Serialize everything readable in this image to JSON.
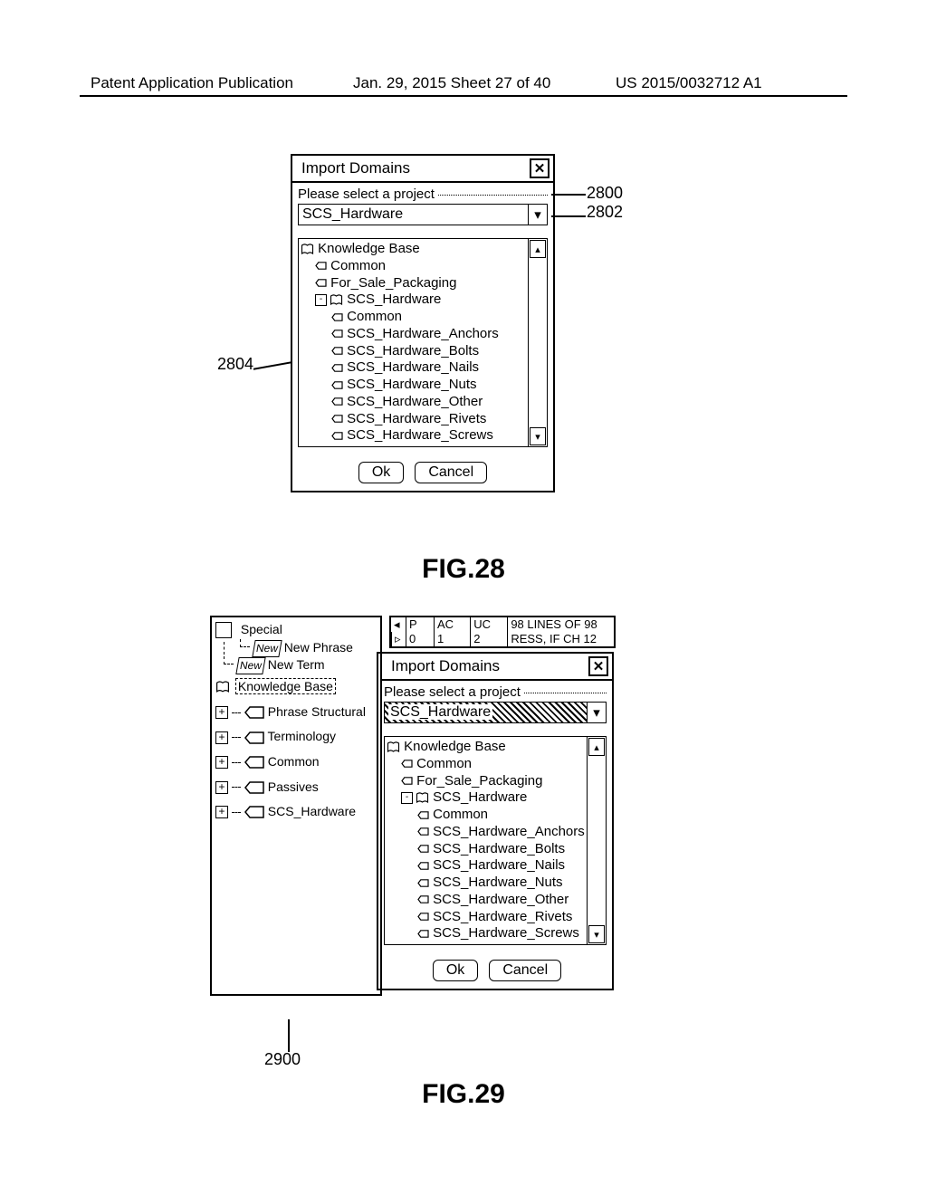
{
  "header": {
    "left": "Patent Application Publication",
    "center": "Jan. 29, 2015  Sheet 27 of 40",
    "right": "US 2015/0032712 A1"
  },
  "fig28": {
    "label": "FIG.28",
    "callouts": {
      "c2800": "2800",
      "c2802": "2802",
      "c2804": "2804"
    },
    "dialog": {
      "title": "Import Domains",
      "prompt": "Please select a project",
      "selectValue": "SCS_Hardware",
      "tree": {
        "root": "Knowledge Base",
        "items": [
          {
            "level": 1,
            "icon": "tag",
            "label": "Common"
          },
          {
            "level": 1,
            "icon": "tag",
            "label": "For_Sale_Packaging"
          },
          {
            "level": 1,
            "icon": "minus-book",
            "label": "SCS_Hardware"
          },
          {
            "level": 2,
            "icon": "tag",
            "label": "Common"
          },
          {
            "level": 2,
            "icon": "tag",
            "label": "SCS_Hardware_Anchors"
          },
          {
            "level": 2,
            "icon": "tag",
            "label": "SCS_Hardware_Bolts"
          },
          {
            "level": 2,
            "icon": "tag",
            "label": "SCS_Hardware_Nails"
          },
          {
            "level": 2,
            "icon": "tag",
            "label": "SCS_Hardware_Nuts"
          },
          {
            "level": 2,
            "icon": "tag",
            "label": "SCS_Hardware_Other"
          },
          {
            "level": 2,
            "icon": "tag",
            "label": "SCS_Hardware_Rivets"
          },
          {
            "level": 2,
            "icon": "tag",
            "label": "SCS_Hardware_Screws"
          }
        ]
      },
      "ok": "Ok",
      "cancel": "Cancel"
    }
  },
  "fig29": {
    "label": "FIG.29",
    "callout": "2900",
    "leftPanel": {
      "special": "Special",
      "newPhrase": {
        "tag": "New",
        "label": "New Phrase"
      },
      "newTerm": {
        "tag": "New",
        "label": "New Term"
      },
      "kb": "Knowledge Base",
      "items": [
        "Phrase Structural",
        "Terminology",
        "Common",
        "Passives",
        "SCS_Hardware"
      ]
    },
    "stats": {
      "row1": {
        "c1": "◂",
        "c2": "P",
        "c3": "AC",
        "c4": "UC",
        "c5": "98 LINES OF 98"
      },
      "row2": {
        "c1": "▹",
        "c2": "0",
        "c3": "1",
        "c4": "2",
        "c5": "RESS, IF CH 12"
      }
    },
    "dialog": {
      "title": "Import Domains",
      "prompt": "Please select a project",
      "selectValue": "SCS_Hardware",
      "tree": {
        "root": "Knowledge Base",
        "items": [
          {
            "level": 1,
            "icon": "tag",
            "label": "Common"
          },
          {
            "level": 1,
            "icon": "tag",
            "label": "For_Sale_Packaging"
          },
          {
            "level": 1,
            "icon": "minus-book",
            "label": "SCS_Hardware"
          },
          {
            "level": 2,
            "icon": "tag",
            "label": "Common"
          },
          {
            "level": 2,
            "icon": "tag",
            "label": "SCS_Hardware_Anchors"
          },
          {
            "level": 2,
            "icon": "tag",
            "label": "SCS_Hardware_Bolts"
          },
          {
            "level": 2,
            "icon": "tag",
            "label": "SCS_Hardware_Nails"
          },
          {
            "level": 2,
            "icon": "tag",
            "label": "SCS_Hardware_Nuts"
          },
          {
            "level": 2,
            "icon": "tag",
            "label": "SCS_Hardware_Other"
          },
          {
            "level": 2,
            "icon": "tag",
            "label": "SCS_Hardware_Rivets"
          },
          {
            "level": 2,
            "icon": "tag",
            "label": "SCS_Hardware_Screws"
          }
        ]
      },
      "ok": "Ok",
      "cancel": "Cancel"
    }
  }
}
